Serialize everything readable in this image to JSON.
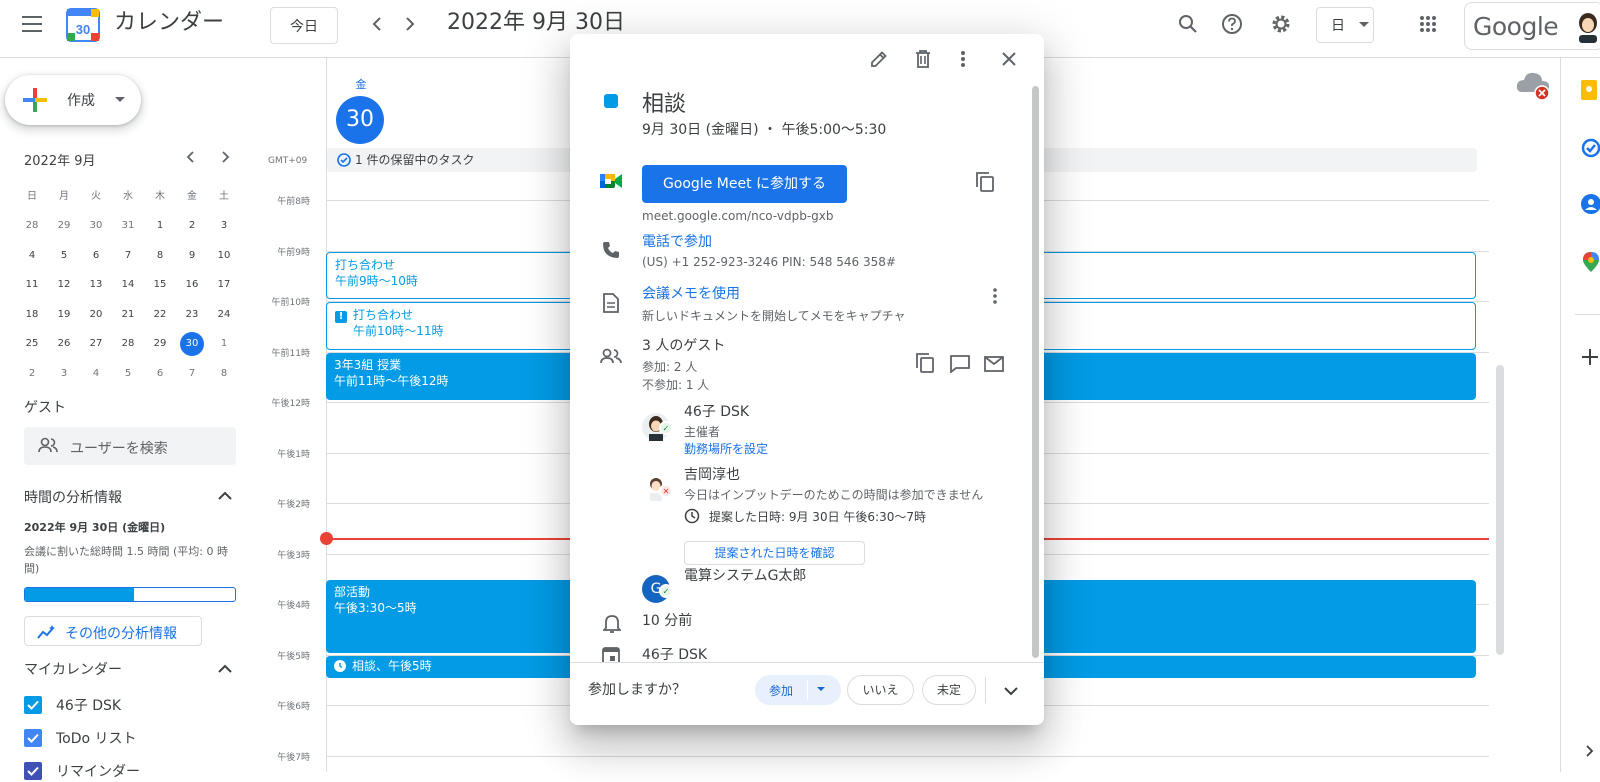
{
  "header": {
    "app_title": "カレンダー",
    "today_label": "今日",
    "date_title": "2022年 9月 30日",
    "view_label": "日",
    "google_word": "Google"
  },
  "sidebar": {
    "create_label": "作成",
    "mini_calendar": {
      "month_label": "2022年 9月",
      "weekdays": [
        "日",
        "月",
        "火",
        "水",
        "木",
        "金",
        "土"
      ],
      "weeks": [
        [
          "28",
          "29",
          "30",
          "31",
          "1",
          "2",
          "3"
        ],
        [
          "4",
          "5",
          "6",
          "7",
          "8",
          "9",
          "10"
        ],
        [
          "11",
          "12",
          "13",
          "14",
          "15",
          "16",
          "17"
        ],
        [
          "18",
          "19",
          "20",
          "21",
          "22",
          "23",
          "24"
        ],
        [
          "25",
          "26",
          "27",
          "28",
          "29",
          "30",
          "1"
        ],
        [
          "2",
          "3",
          "4",
          "5",
          "6",
          "7",
          "8"
        ]
      ],
      "selected_day": "30"
    },
    "guests_heading": "ゲスト",
    "guest_search_placeholder": "ユーザーを検索",
    "analysis": {
      "heading": "時間の分析情報",
      "date": "2022年 9月 30日 (金曜日)",
      "text": "会議に割いた総時間 1.5 時間 (平均: 0 時間)",
      "meeting_fraction": 0.53,
      "more_label": "その他の分析情報"
    },
    "my_calendars": {
      "heading": "マイカレンダー",
      "items": [
        {
          "label": "46子 DSK",
          "color": "#039be5"
        },
        {
          "label": "ToDo リスト",
          "color": "#4285f4"
        },
        {
          "label": "リマインダー",
          "color": "#3f51b5"
        }
      ]
    }
  },
  "calendar": {
    "day_name": "金",
    "day_number": "30",
    "timezone": "GMT+09",
    "allday_task": "1 件の保留中のタスク",
    "hours": [
      "午前8時",
      "午前9時",
      "午前10時",
      "午前11時",
      "午後12時",
      "午後1時",
      "午後2時",
      "午後3時",
      "午後4時",
      "午後5時",
      "午後6時",
      "午後7時"
    ],
    "events": [
      {
        "title": "打ち合わせ",
        "time": "午前9時～10時",
        "style": "outline",
        "start": 9,
        "end": 10
      },
      {
        "title": "打ち合わせ",
        "time": "午前10時～11時",
        "style": "outline",
        "start": 10,
        "end": 11,
        "warning": true
      },
      {
        "title": "3年3組 授業",
        "time": "午前11時～午後12時",
        "style": "solid",
        "start": 11,
        "end": 12
      },
      {
        "title": "部活動",
        "time": "午後3:30～5時",
        "style": "solid",
        "start": 15.5,
        "end": 17
      },
      {
        "title": "相談、午後5時",
        "time": "",
        "style": "solid",
        "start": 17,
        "end": 17.5,
        "clock": true
      }
    ],
    "now_hour": 14.7
  },
  "popup": {
    "title": "相談",
    "datetime": "9月 30日 (金曜日) ・ 午後5:00～5:30",
    "meet_button": "Google Meet に参加する",
    "meet_url": "meet.google.com/nco-vdpb-gxb",
    "phone_link": "電話で参加",
    "phone_detail": "(US) +1 252-923-3246 PIN: 548 546 358#",
    "notes_link": "会議メモを使用",
    "notes_detail": "新しいドキュメントを開始してメモをキャプチャ",
    "guests_count": "3 人のゲスト",
    "guests_yes": "参加: 2 人",
    "guests_no": "不参加: 1 人",
    "guests": [
      {
        "name": "46子 DSK",
        "role": "主催者",
        "link": "勤務場所を設定",
        "status": "yes"
      },
      {
        "name": "吉岡淳也",
        "comment": "今日はインプットデーのためこの時間は参加できません",
        "proposal": "提案した日時: 9月 30日 午後6:30～7時",
        "confirm": "提案された日時を確認",
        "status": "no"
      },
      {
        "name": "電算システムG太郎",
        "initial": "G",
        "status": "yes"
      }
    ],
    "reminder": "10 分前",
    "calendar_owner": "46子 DSK",
    "rsvp": {
      "question": "参加しますか？",
      "yes": "参加",
      "no": "いいえ",
      "maybe": "未定"
    }
  },
  "colors": {
    "accent": "#1a73e8",
    "event": "#039be5",
    "now": "#ea4335"
  }
}
